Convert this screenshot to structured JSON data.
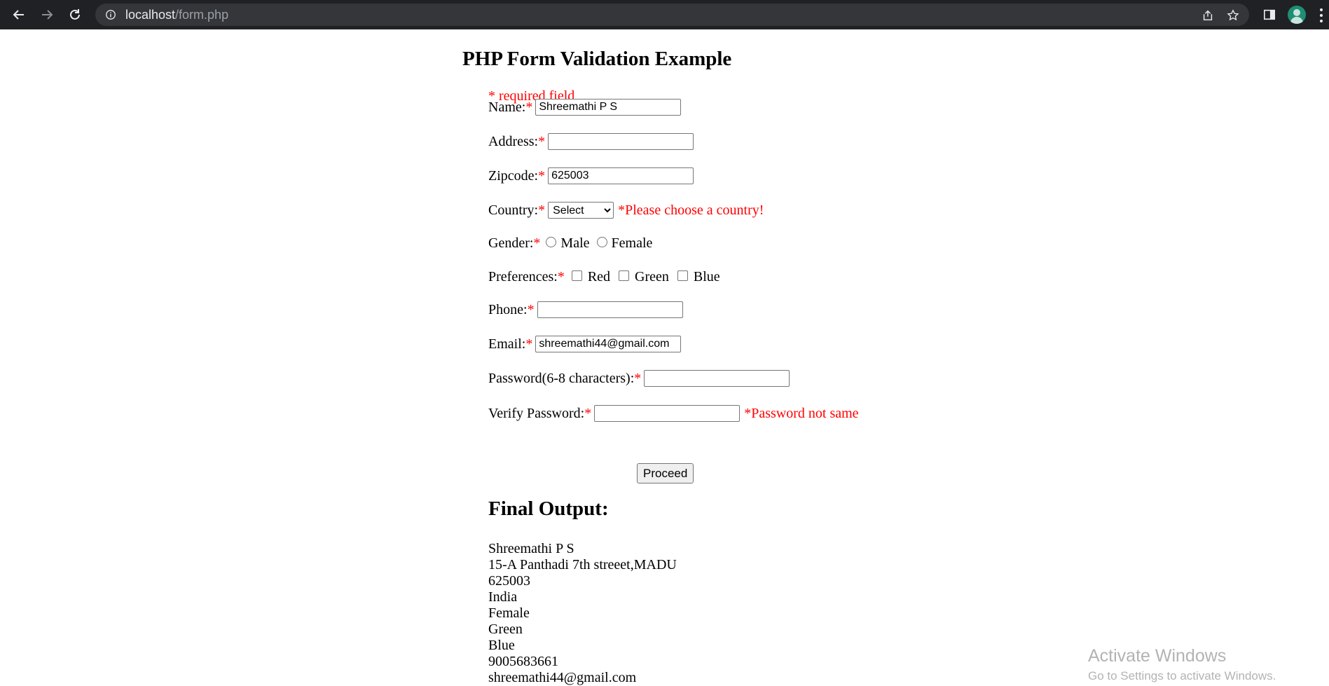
{
  "browser": {
    "url_host": "localhost",
    "url_path": "/form.php"
  },
  "page": {
    "title": "PHP Form Validation Example",
    "required_note": "* required field",
    "star": "*",
    "fields": {
      "name": {
        "label": "Name:",
        "value": "Shreemathi P S"
      },
      "address": {
        "label": "Address:",
        "value": ""
      },
      "zipcode": {
        "label": "Zipcode:",
        "value": "625003"
      },
      "country": {
        "label": "Country:",
        "selected": "Select",
        "error": "*Please choose a country!"
      },
      "gender": {
        "label": "Gender:",
        "options": [
          "Male",
          "Female"
        ]
      },
      "preferences": {
        "label": "Preferences:",
        "options": [
          "Red",
          "Green",
          "Blue"
        ]
      },
      "phone": {
        "label": "Phone:",
        "value": ""
      },
      "email": {
        "label": "Email:",
        "value": "shreemathi44@gmail.com"
      },
      "password": {
        "label": "Password(6-8 characters):",
        "value": ""
      },
      "verify_password": {
        "label": "Verify Password:",
        "value": "",
        "error": "*Password not same"
      }
    },
    "submit_label": "Proceed",
    "final_heading": "Final Output:",
    "output_lines": [
      "Shreemathi P S",
      "15-A Panthadi 7th streeet,MADU",
      "625003",
      "India",
      "Female",
      "Green",
      "Blue",
      "9005683661",
      "shreemathi44@gmail.com"
    ]
  },
  "watermark": {
    "line1": "Activate Windows",
    "line2": "Go to Settings to activate Windows."
  },
  "colors": {
    "error": "#ff0000",
    "chrome_bg": "#202124",
    "omnibox_bg": "#35363a"
  }
}
